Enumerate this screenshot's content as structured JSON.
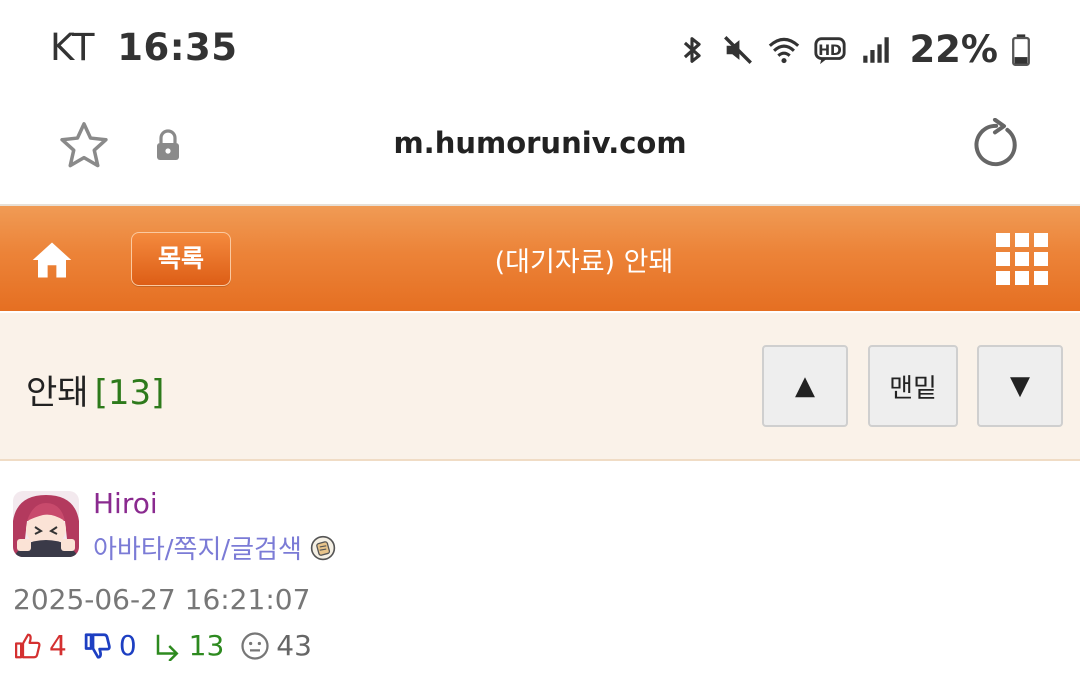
{
  "status_bar": {
    "carrier": "KT",
    "time": "16:35",
    "battery": "22%",
    "icons": [
      "bluetooth-icon",
      "mute-icon",
      "wifi-icon",
      "hd-voice-icon",
      "signal-icon",
      "battery-icon"
    ]
  },
  "browser": {
    "url": "m.humoruniv.com",
    "icons": [
      "star-icon",
      "lock-icon",
      "reload-icon"
    ]
  },
  "header": {
    "list_label": "목록",
    "title": "(대기자료) 안돼",
    "icons": [
      "home-icon",
      "grid-menu-icon"
    ],
    "colors": {
      "header_orange": "#ec8338",
      "header_dark": "#e56f22"
    }
  },
  "post": {
    "title": "안돼",
    "comment_count": "[13]",
    "nav": {
      "up_glyph": "▲",
      "bottom_label": "맨밑",
      "down_glyph": "▼"
    }
  },
  "author": {
    "name": "Hiroi",
    "links": "아바타/쪽지/글검색",
    "colors": {
      "name": "#8a2a8f",
      "links": "#7b7bd6"
    }
  },
  "meta": {
    "date": "2025-06-27 16:21:07",
    "up_count": "4",
    "down_count": "0",
    "reply_count": "13",
    "view_count": "43",
    "colors": {
      "up": "#d43030",
      "down": "#1d3fc2",
      "reply": "#2d8a1f",
      "view": "#666666"
    }
  }
}
